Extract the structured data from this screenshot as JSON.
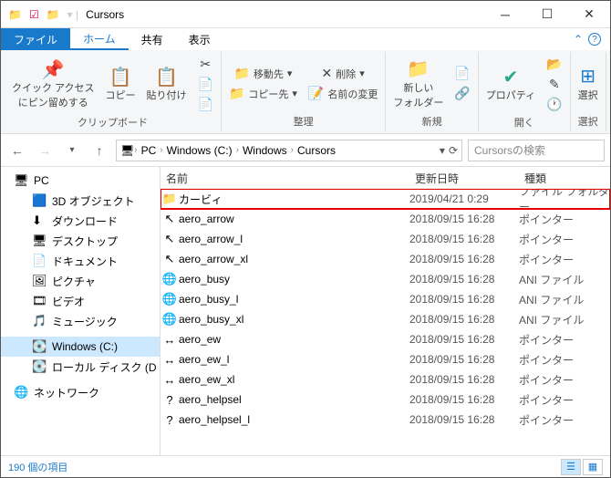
{
  "titlebar": {
    "title": "Cursors"
  },
  "tabs": {
    "file": "ファイル",
    "home": "ホーム",
    "share": "共有",
    "view": "表示"
  },
  "ribbon": {
    "pin": "クイック アクセス\nにピン留めする",
    "copy": "コピー",
    "paste": "貼り付け",
    "group1": "クリップボード",
    "moveto": "移動先",
    "copyto": "コピー先",
    "delete": "削除",
    "rename": "名前の変更",
    "group2": "整理",
    "newfolder": "新しい\nフォルダー",
    "group3": "新規",
    "properties": "プロパティ",
    "group4": "開く",
    "select": "選択",
    "group5": "選択"
  },
  "breadcrumb": [
    "PC",
    "Windows (C:)",
    "Windows",
    "Cursors"
  ],
  "search_placeholder": "Cursorsの検索",
  "tree": [
    {
      "icon": "🖥",
      "label": "PC",
      "lvl": 0
    },
    {
      "icon": "🟦",
      "label": "3D オブジェクト",
      "lvl": 1
    },
    {
      "icon": "⬇",
      "label": "ダウンロード",
      "lvl": 1
    },
    {
      "icon": "🖥",
      "label": "デスクトップ",
      "lvl": 1
    },
    {
      "icon": "📄",
      "label": "ドキュメント",
      "lvl": 1
    },
    {
      "icon": "🖼",
      "label": "ピクチャ",
      "lvl": 1
    },
    {
      "icon": "🎞",
      "label": "ビデオ",
      "lvl": 1
    },
    {
      "icon": "🎵",
      "label": "ミュージック",
      "lvl": 1
    },
    {
      "icon": "💽",
      "label": "Windows (C:)",
      "lvl": 1,
      "sel": true
    },
    {
      "icon": "💽",
      "label": "ローカル ディスク (D",
      "lvl": 1
    },
    {
      "icon": "🌐",
      "label": "ネットワーク",
      "lvl": 0
    }
  ],
  "columns": {
    "name": "名前",
    "date": "更新日時",
    "type": "種類"
  },
  "files": [
    {
      "icon": "📁",
      "name": "カービィ",
      "date": "2019/04/21 0:29",
      "type": "ファイル フォルダー",
      "hl": true
    },
    {
      "icon": "↖",
      "name": "aero_arrow",
      "date": "2018/09/15 16:28",
      "type": "ポインター"
    },
    {
      "icon": "↖",
      "name": "aero_arrow_l",
      "date": "2018/09/15 16:28",
      "type": "ポインター"
    },
    {
      "icon": "↖",
      "name": "aero_arrow_xl",
      "date": "2018/09/15 16:28",
      "type": "ポインター"
    },
    {
      "icon": "🌐",
      "name": "aero_busy",
      "date": "2018/09/15 16:28",
      "type": "ANI ファイル"
    },
    {
      "icon": "🌐",
      "name": "aero_busy_l",
      "date": "2018/09/15 16:28",
      "type": "ANI ファイル"
    },
    {
      "icon": "🌐",
      "name": "aero_busy_xl",
      "date": "2018/09/15 16:28",
      "type": "ANI ファイル"
    },
    {
      "icon": "↔",
      "name": "aero_ew",
      "date": "2018/09/15 16:28",
      "type": "ポインター"
    },
    {
      "icon": "↔",
      "name": "aero_ew_l",
      "date": "2018/09/15 16:28",
      "type": "ポインター"
    },
    {
      "icon": "↔",
      "name": "aero_ew_xl",
      "date": "2018/09/15 16:28",
      "type": "ポインター"
    },
    {
      "icon": "?",
      "name": "aero_helpsel",
      "date": "2018/09/15 16:28",
      "type": "ポインター"
    },
    {
      "icon": "?",
      "name": "aero_helpsel_l",
      "date": "2018/09/15 16:28",
      "type": "ポインター"
    }
  ],
  "status": {
    "count": "190 個の項目"
  }
}
